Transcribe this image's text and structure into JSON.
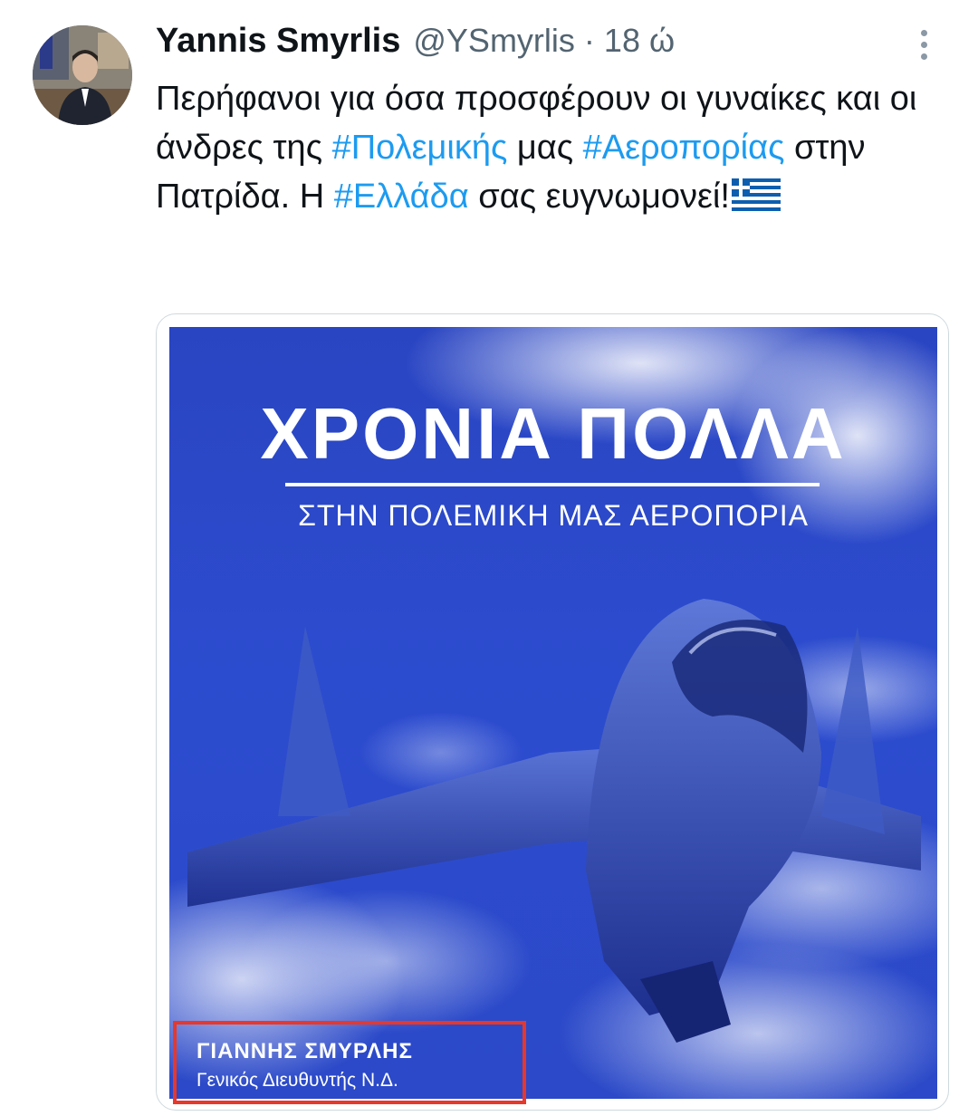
{
  "tweet": {
    "author_name": "Yannis Smyrlis",
    "author_handle": "@YSmyrlis",
    "separator": "·",
    "timestamp": "18 ώ",
    "text_1": "Περήφανοι για όσα προσφέρουν οι γυναίκες και οι άνδρες της ",
    "hashtag_1": "#Πολεμικής",
    "text_2": " μας ",
    "hashtag_2": "#Αεροπορίας",
    "text_3": " στην Πατρίδα. Η ",
    "hashtag_3": "#Ελλάδα",
    "text_4": " σας ευγνωμονεί!",
    "hashtag_color": "#1d9bf0"
  },
  "poster": {
    "title": "ΧΡΟΝΙΑ ΠΟΛΛΑ",
    "subtitle": "ΣΤΗΝ ΠΟΛΕΜΙΚΗ ΜΑΣ ΑΕΡΟΠΟΡΙΑ",
    "signature_name": "ΓΙΑΝΝΗΣ ΣΜΥΡΛΗΣ",
    "signature_role": "Γενικός Διευθυντής Ν.Δ.",
    "background_color": "#2b49c8",
    "highlight_color": "#e8372b"
  },
  "icons": {
    "more": "more-options-icon",
    "flag": "greece-flag-icon"
  }
}
